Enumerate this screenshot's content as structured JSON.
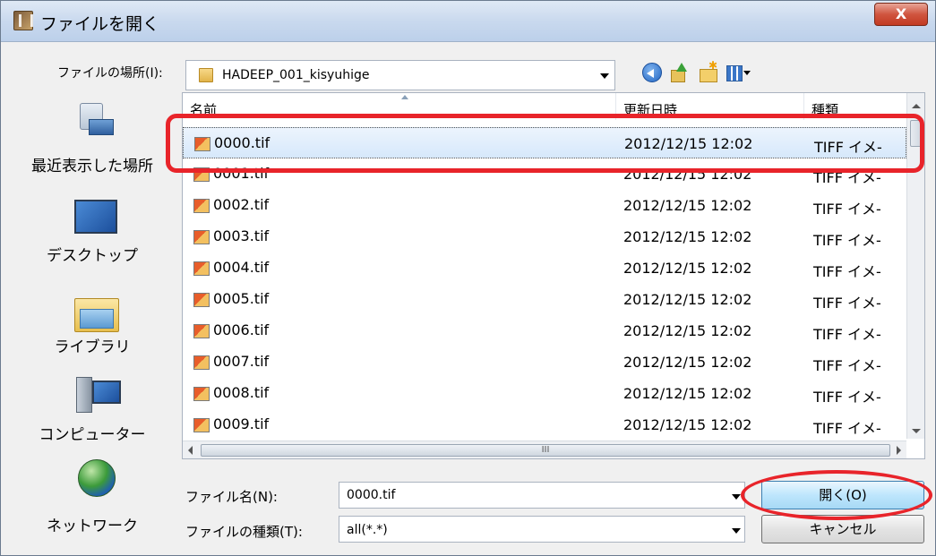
{
  "window": {
    "title": "ファイルを開く",
    "close_label": "X"
  },
  "location": {
    "label": "ファイルの場所(I):",
    "folder": "HADEEP_001_kisyuhige"
  },
  "places": [
    {
      "label": "最近表示した場所",
      "icon": "recent-places-icon"
    },
    {
      "label": "デスクトップ",
      "icon": "desktop-icon"
    },
    {
      "label": "ライブラリ",
      "icon": "libraries-icon"
    },
    {
      "label": "コンピューター",
      "icon": "computer-icon"
    },
    {
      "label": "ネットワーク",
      "icon": "network-icon"
    }
  ],
  "columns": {
    "name": "名前",
    "date": "更新日時",
    "type": "種類"
  },
  "files": [
    {
      "name": "0000.tif",
      "date": "2012/12/15 12:02",
      "type": "TIFF イメ-"
    },
    {
      "name": "0001.tif",
      "date": "2012/12/15 12:02",
      "type": "TIFF イメ-"
    },
    {
      "name": "0002.tif",
      "date": "2012/12/15 12:02",
      "type": "TIFF イメ-"
    },
    {
      "name": "0003.tif",
      "date": "2012/12/15 12:02",
      "type": "TIFF イメ-"
    },
    {
      "name": "0004.tif",
      "date": "2012/12/15 12:02",
      "type": "TIFF イメ-"
    },
    {
      "name": "0005.tif",
      "date": "2012/12/15 12:02",
      "type": "TIFF イメ-"
    },
    {
      "name": "0006.tif",
      "date": "2012/12/15 12:02",
      "type": "TIFF イメ-"
    },
    {
      "name": "0007.tif",
      "date": "2012/12/15 12:02",
      "type": "TIFF イメ-"
    },
    {
      "name": "0008.tif",
      "date": "2012/12/15 12:02",
      "type": "TIFF イメ-"
    },
    {
      "name": "0009.tif",
      "date": "2012/12/15 12:02",
      "type": "TIFF イメ-"
    }
  ],
  "hscroll_grip": "III",
  "filename": {
    "label": "ファイル名(N):",
    "value": "0000.tif"
  },
  "filetype": {
    "label": "ファイルの種類(T):",
    "value": "all(*.*)"
  },
  "buttons": {
    "open": "開く(O)",
    "cancel": "キャンセル"
  },
  "colors": {
    "highlight": "#e8242a",
    "selection": "#d6e8fb"
  }
}
